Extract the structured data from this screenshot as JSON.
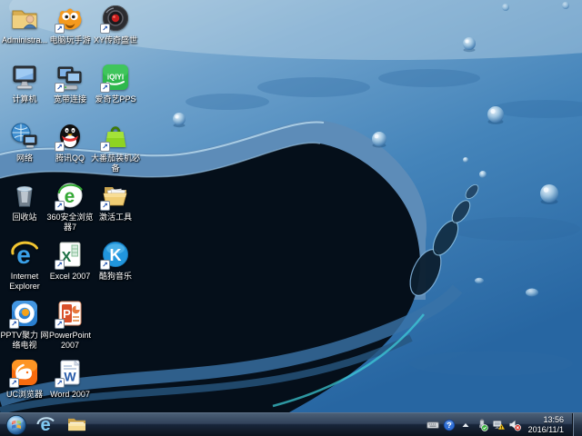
{
  "desktop": {
    "shortcut_glyph": "↗",
    "icons": [
      {
        "name": "administrator-folder",
        "label": "Administra...",
        "type": "admin",
        "col": 1,
        "row": 1,
        "shortcut": false
      },
      {
        "name": "pc-mobile-game",
        "label": "电脑玩手游",
        "type": "monster",
        "col": 2,
        "row": 1,
        "shortcut": true
      },
      {
        "name": "xy-legend-game",
        "label": "XY传奇盛世",
        "type": "xy",
        "col": 3,
        "row": 1,
        "shortcut": true
      },
      {
        "name": "computer",
        "label": "计算机",
        "type": "computer",
        "col": 1,
        "row": 2,
        "shortcut": false
      },
      {
        "name": "broadband-connection",
        "label": "宽带连接",
        "type": "broadband",
        "col": 2,
        "row": 2,
        "shortcut": true
      },
      {
        "name": "iqiyi-pps",
        "label": "爱奇艺PPS",
        "type": "iqiyi",
        "glyph": "iQIYI",
        "col": 3,
        "row": 2,
        "shortcut": true
      },
      {
        "name": "network",
        "label": "网络",
        "type": "network",
        "col": 1,
        "row": 3,
        "shortcut": false
      },
      {
        "name": "tencent-qq",
        "label": "腾讯QQ",
        "type": "qq",
        "col": 2,
        "row": 3,
        "shortcut": true
      },
      {
        "name": "tomato-essentials",
        "label": "大番茄装机必备",
        "type": "bag",
        "col": 3,
        "row": 3,
        "shortcut": true
      },
      {
        "name": "recycle-bin",
        "label": "回收站",
        "type": "recycle",
        "col": 1,
        "row": 4,
        "shortcut": false
      },
      {
        "name": "360-secure-browser",
        "label": "360安全浏览器7",
        "type": "e360",
        "glyph": "e",
        "col": 2,
        "row": 4,
        "shortcut": true
      },
      {
        "name": "activation-tool",
        "label": "激活工具",
        "type": "folderopen",
        "col": 3,
        "row": 4,
        "shortcut": true
      },
      {
        "name": "internet-explorer",
        "label": "Internet Explorer",
        "type": "ie",
        "glyph": "e",
        "col": 1,
        "row": 5,
        "shortcut": false
      },
      {
        "name": "excel-2007",
        "label": "Excel 2007",
        "type": "excel",
        "glyph": "X",
        "col": 2,
        "row": 5,
        "shortcut": true
      },
      {
        "name": "kugou-music",
        "label": "酷狗音乐",
        "type": "kugou",
        "glyph": "K",
        "col": 3,
        "row": 5,
        "shortcut": true
      },
      {
        "name": "pptv",
        "label": "PPTV聚力 网络电视",
        "type": "pptv",
        "col": 1,
        "row": 6,
        "shortcut": true
      },
      {
        "name": "powerpoint-2007",
        "label": "PowerPoint 2007",
        "type": "ppt",
        "glyph": "P",
        "col": 2,
        "row": 6,
        "shortcut": true
      },
      {
        "name": "uc-browser",
        "label": "UC浏览器",
        "type": "uc",
        "col": 1,
        "row": 7,
        "shortcut": true
      },
      {
        "name": "word-2007",
        "label": "Word 2007",
        "type": "word",
        "glyph": "W",
        "col": 2,
        "row": 7,
        "shortcut": true
      }
    ]
  },
  "taskbar": {
    "start": {
      "name": "start-button"
    },
    "pinned": [
      {
        "name": "taskbar-ie",
        "type": "ie-task",
        "glyph": "e"
      },
      {
        "name": "taskbar-explorer",
        "type": "folder-task"
      }
    ],
    "tray": {
      "icons": [
        {
          "name": "input-method-icon",
          "type": "keyboard"
        },
        {
          "name": "help-tray-icon",
          "type": "help",
          "glyph": "?"
        },
        {
          "name": "show-hidden-icons-button",
          "type": "uparrow"
        },
        {
          "name": "safely-remove-hardware-icon",
          "type": "plugok"
        },
        {
          "name": "network-warning-icon",
          "type": "netwarn"
        },
        {
          "name": "volume-muted-icon",
          "type": "volmute"
        }
      ],
      "clock": {
        "time": "13:56",
        "date": "2016/11/1"
      }
    }
  },
  "theme": {
    "taskbar_top": "#42556b",
    "taskbar_bottom": "#0b131d",
    "label_color": "#ffffff",
    "wallpaper_light": "#a7c6dc",
    "wallpaper_mid": "#4484ba",
    "wallpaper_deep": "#2766a2",
    "splash_dark": "#050f1a",
    "droplet_rim": "#e8f3fb",
    "accent_cyan": "#3fd2dc"
  }
}
